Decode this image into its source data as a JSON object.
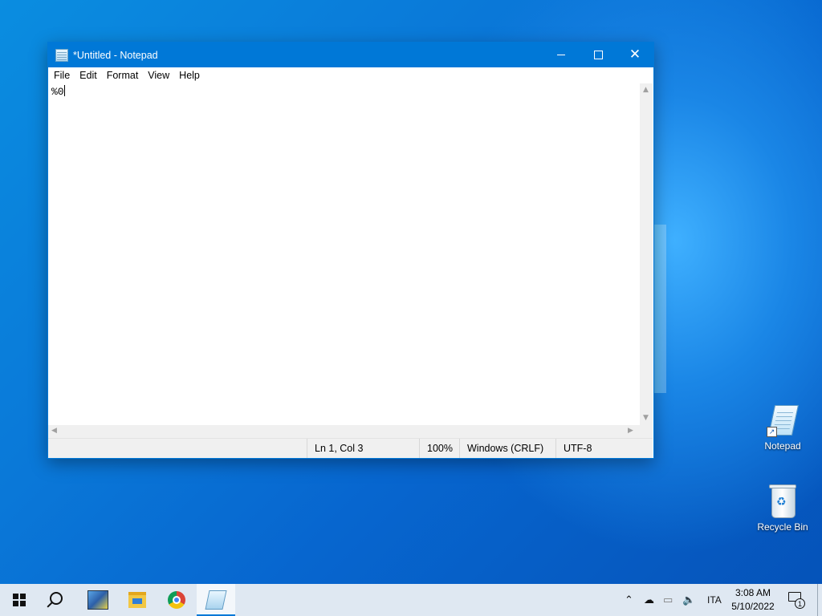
{
  "window": {
    "title": "*Untitled - Notepad",
    "menu": [
      "File",
      "Edit",
      "Format",
      "View",
      "Help"
    ],
    "content": "%0",
    "status": {
      "position": "Ln 1, Col 3",
      "zoom": "100%",
      "line_ending": "Windows (CRLF)",
      "encoding": "UTF-8"
    },
    "icons": [
      "notepad-icon",
      "minimize-icon",
      "maximize-icon",
      "close-icon"
    ]
  },
  "desktop": {
    "icons": [
      {
        "label": "Notepad",
        "icon": "notepad-icon"
      },
      {
        "label": "Recycle Bin",
        "icon": "recycle-bin-icon"
      }
    ]
  },
  "taskbar": {
    "apps": [
      "start",
      "search",
      "photos",
      "file-explorer",
      "chrome",
      "notepad"
    ],
    "active_app": "notepad",
    "tray": {
      "language": "ITA",
      "time": "3:08 AM",
      "date": "5/10/2022",
      "notification_count": "1"
    }
  },
  "colors": {
    "accent": "#0078d7",
    "taskbar": "#dfe8f2"
  }
}
